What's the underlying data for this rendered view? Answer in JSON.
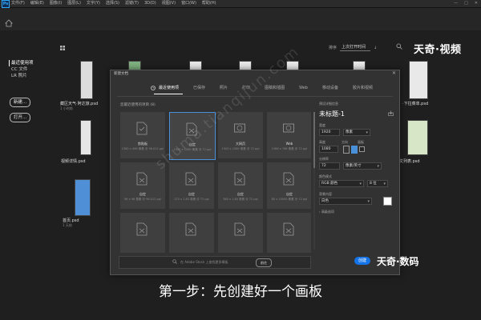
{
  "menubar": {
    "logo": "Ps",
    "items": [
      "文件(F)",
      "编辑(E)",
      "图像(I)",
      "图层(L)",
      "文字(Y)",
      "选择(S)",
      "滤镜(T)",
      "3D(D)",
      "视图(V)",
      "窗口(W)",
      "帮助(H)"
    ],
    "window_buttons": [
      "—",
      "□",
      "✕"
    ]
  },
  "sidebar": {
    "items": [
      "最近使用项",
      "CC 文件",
      "LR 照片"
    ],
    "new_button": "新建...",
    "open_button": "打开..."
  },
  "home": {
    "sort_label": "排序",
    "sort_value": "上次打开时间",
    "sort_arrow": "↓",
    "watermark_top": "天奇·视频"
  },
  "files": [
    {
      "name": "藏区天气·阿达旅.psd",
      "meta": "1 小时前"
    },
    {
      "name": "·下拉菜单.psd",
      "meta": ""
    },
    {
      "name": "视频详情.psd",
      "meta": ""
    },
    {
      "name": "文列表.psd",
      "meta": ""
    },
    {
      "name": "首页.psd",
      "meta": "1 天前"
    }
  ],
  "dialog": {
    "title": "新建文档",
    "close": "✕",
    "tabs": [
      "最近使用项",
      "已保存",
      "照片",
      "打印",
      "图稿和插图",
      "Web",
      "移动设备",
      "胶片和视频"
    ],
    "recent_label": "您最近使用的项目 (8)",
    "presets": [
      {
        "name": "剪贴板",
        "size": "1380 x 496 像素 @ 96.012 ppi"
      },
      {
        "name": "自定",
        "size": "1920 x 1080 像素 @ 72 ppi"
      },
      {
        "name": "大网页",
        "size": "1920 x 1080 像素 @ 72 ppi"
      },
      {
        "name": "Web",
        "size": "1366 x 768 像素 @ 72 ppi"
      },
      {
        "name": "自定",
        "size": "96 x 96 像素 @ 96.012 ppi"
      },
      {
        "name": "自定",
        "size": "270 x 1.85 像素 @ 72 ppi"
      },
      {
        "name": "自定",
        "size": "360 x 1.80 像素 @ 72 ppi"
      },
      {
        "name": "自定",
        "size": "80 x 10000 像素 @ 72 ppi"
      },
      {
        "name": "",
        "size": ""
      },
      {
        "name": "",
        "size": ""
      },
      {
        "name": "",
        "size": ""
      },
      {
        "name": "",
        "size": ""
      }
    ],
    "stock_placeholder": "在 Adobe Stock 上查找更多模板",
    "stock_button": "前往",
    "details": {
      "header": "预设详细信息",
      "doc_name": "未标题-1",
      "width_label": "宽度",
      "width_value": "1920",
      "width_unit": "像素",
      "height_label": "高度",
      "height_value": "1080",
      "orientation_label": "方向",
      "artboard_label": "画板",
      "resolution_label": "分辨率",
      "resolution_value": "72",
      "resolution_unit": "像素/英寸",
      "color_mode_label": "颜色模式",
      "color_mode_value": "RGB 颜色",
      "bit_depth": "8 位",
      "bg_label": "背景内容",
      "bg_value": "白色",
      "advanced": "高级选项"
    },
    "create_button": "创建"
  },
  "watermark_bottom": "天奇·数码",
  "watermark_diagonal": "shuma.tianqijun.com",
  "caption": "第一步：先创建好一个画板",
  "colors": {
    "accent": "#1473e6",
    "selection": "#4a90d9"
  }
}
